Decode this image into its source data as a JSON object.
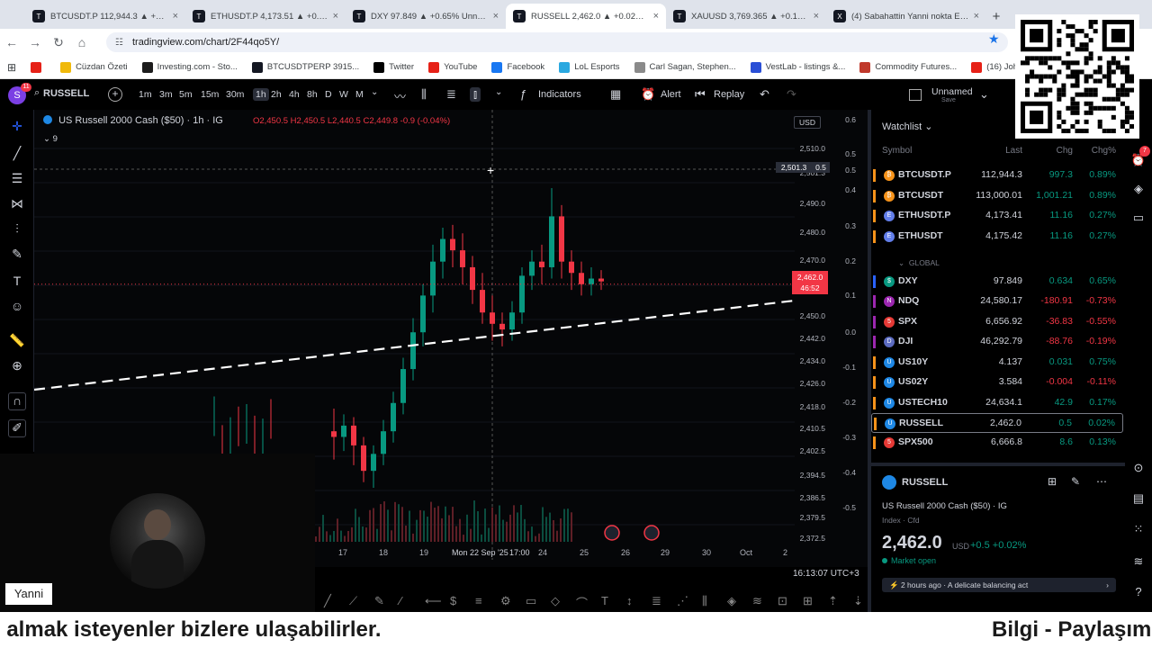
{
  "browser": {
    "tabs": [
      {
        "title": "BTCUSDT.P 112,944.3 ▲ +0.89%",
        "icon": "T"
      },
      {
        "title": "ETHUSDT.P 4,173.51 ▲ +0.27%",
        "icon": "T"
      },
      {
        "title": "DXY 97.849 ▲ +0.65% Unname",
        "icon": "T"
      },
      {
        "title": "RUSSELL 2,462.0 ▲ +0.02% Un",
        "icon": "T"
      },
      {
        "title": "XAUUSD 3,769.365 ▲ +0.14%",
        "icon": "T"
      },
      {
        "title": "(4) Sabahattin Yanni nokta Eteh",
        "icon": "X"
      }
    ],
    "url": "tradingview.com/chart/2F44qo5Y/",
    "bookmarks": [
      {
        "label": "",
        "color": "#e62117"
      },
      {
        "label": "Cüzdan Özeti",
        "color": "#f0b90b"
      },
      {
        "label": "Investing.com - Sto...",
        "color": "#1c1c1c"
      },
      {
        "label": "BTCUSDTPERP 3915...",
        "color": "#131722"
      },
      {
        "label": "Twitter",
        "color": "#000000"
      },
      {
        "label": "YouTube",
        "color": "#e62117"
      },
      {
        "label": "Facebook",
        "color": "#1877f2"
      },
      {
        "label": "LoL Esports",
        "color": "#2aa8e0"
      },
      {
        "label": "Carl Sagan, Stephen...",
        "color": "#8a8a8a"
      },
      {
        "label": "VestLab - listings &...",
        "color": "#2a4fd6"
      },
      {
        "label": "Commodity Futures...",
        "color": "#c0392b"
      },
      {
        "label": "(16) Johnny Cash -...",
        "color": "#e62117"
      }
    ]
  },
  "header": {
    "avatar_letter": "S",
    "avatar_badge": "11",
    "symbol": "RUSSELL",
    "timeframes": [
      "1m",
      "3m",
      "5m",
      "15m",
      "30m",
      "1h",
      "2h",
      "4h",
      "8h",
      "D",
      "W",
      "M"
    ],
    "active_timeframe": "1h",
    "indicators_label": "Indicators",
    "alert_label": "Alert",
    "replay_label": "Replay",
    "layout_name": "Unnamed",
    "layout_sub": "Save"
  },
  "chart": {
    "title": "US Russell 2000 Cash ($50) · 1h · IG",
    "ohlc": "O2,450.5 H2,450.5 L2,440.5 C2,449.8 -0.9 (-0.04%)",
    "indicator_count": "9",
    "currency": "USD",
    "price_ticks": [
      "2,510.0",
      "2,501.3",
      "2,490.0",
      "2,480.0",
      "2,470.0",
      "2,462.0",
      "2,450.0",
      "2,442.0",
      "2,434.0",
      "2,426.0",
      "2,418.0",
      "2,410.5",
      "2,402.5",
      "2,394.5",
      "2,386.5",
      "2,379.5",
      "2,372.5"
    ],
    "pct_ticks": [
      "0.6",
      "0.5",
      "0.5",
      "0.4",
      "0.3",
      "0.2",
      "0.1",
      "0.0",
      "-0.1",
      "-0.2",
      "-0.3",
      "-0.4",
      "-0.5"
    ],
    "last_price": "2,462.0",
    "countdown": "46:52",
    "crosshair_price": "2,501.3",
    "crosshair_pct": "0.5",
    "x_ticks": [
      "17",
      "18",
      "19",
      "Mon 22 Sep '25",
      "17:00",
      "24",
      "25",
      "26",
      "29",
      "30",
      "Oct",
      "2"
    ],
    "clock": "16:13:07 UTC+3",
    "candles": [
      [
        2410,
        2408,
        2400,
        2418
      ],
      [
        2408,
        2412,
        2403,
        2416
      ],
      [
        2412,
        2405,
        2398,
        2415
      ],
      [
        2405,
        2396,
        2392,
        2408
      ],
      [
        2396,
        2402,
        2390,
        2405
      ],
      [
        2402,
        2410,
        2398,
        2414
      ],
      [
        2410,
        2420,
        2406,
        2424
      ],
      [
        2420,
        2432,
        2416,
        2436
      ],
      [
        2432,
        2445,
        2428,
        2450
      ],
      [
        2445,
        2458,
        2440,
        2462
      ],
      [
        2458,
        2470,
        2452,
        2476
      ],
      [
        2470,
        2478,
        2464,
        2482
      ],
      [
        2478,
        2474,
        2468,
        2483
      ],
      [
        2474,
        2468,
        2462,
        2480
      ],
      [
        2468,
        2460,
        2455,
        2472
      ],
      [
        2460,
        2452,
        2448,
        2466
      ],
      [
        2452,
        2448,
        2442,
        2458
      ],
      [
        2448,
        2446,
        2440,
        2452
      ],
      [
        2446,
        2452,
        2442,
        2456
      ],
      [
        2452,
        2465,
        2448,
        2468
      ],
      [
        2465,
        2470,
        2460,
        2474
      ],
      [
        2470,
        2468,
        2462,
        2476
      ],
      [
        2468,
        2486,
        2464,
        2496
      ],
      [
        2486,
        2470,
        2464,
        2490
      ],
      [
        2470,
        2466,
        2460,
        2474
      ],
      [
        2466,
        2462,
        2458,
        2470
      ],
      [
        2462,
        2464,
        2458,
        2468
      ],
      [
        2464,
        2463,
        2460,
        2467
      ]
    ]
  },
  "watchlist": {
    "title": "Watchlist",
    "columns": [
      "Symbol",
      "Last",
      "Chg",
      "Chg%"
    ],
    "section": "GLOBAL",
    "rows": [
      {
        "sym": "BTCUSDT.P",
        "last": "112,944.3",
        "chg": "997.3",
        "chgp": "0.89%",
        "dir": "pos",
        "dot": "#f7931a",
        "flag": "#f7931a",
        "icon": "₿"
      },
      {
        "sym": "BTCUSDT",
        "last": "113,000.01",
        "chg": "1,001.21",
        "chgp": "0.89%",
        "dir": "pos",
        "dot": "#f7931a",
        "flag": "#f7931a",
        "icon": "₿"
      },
      {
        "sym": "ETHUSDT.P",
        "last": "4,173.41",
        "chg": "11.16",
        "chgp": "0.27%",
        "dir": "pos",
        "dot": "#627eea",
        "flag": "#f7931a",
        "icon": "E"
      },
      {
        "sym": "ETHUSDT",
        "last": "4,175.42",
        "chg": "11.16",
        "chgp": "0.27%",
        "dir": "pos",
        "dot": "#627eea",
        "flag": "#f7931a",
        "icon": "E"
      },
      {
        "sym": "DXY",
        "last": "97.849",
        "chg": "0.634",
        "chgp": "0.65%",
        "dir": "pos",
        "dot": "#089981",
        "flag": "#2962ff",
        "icon": "$"
      },
      {
        "sym": "NDQ",
        "last": "24,580.17",
        "chg": "-180.91",
        "chgp": "-0.73%",
        "dir": "neg",
        "dot": "#9c27b0",
        "flag": "#9c27b0",
        "icon": "N"
      },
      {
        "sym": "SPX",
        "last": "6,656.92",
        "chg": "-36.83",
        "chgp": "-0.55%",
        "dir": "neg",
        "dot": "#e53935",
        "flag": "#9c27b0",
        "icon": "5"
      },
      {
        "sym": "DJI",
        "last": "46,292.79",
        "chg": "-88.76",
        "chgp": "-0.19%",
        "dir": "neg",
        "dot": "#5c6bc0",
        "flag": "#9c27b0",
        "icon": "D"
      },
      {
        "sym": "US10Y",
        "last": "4.137",
        "chg": "0.031",
        "chgp": "0.75%",
        "dir": "pos",
        "dot": "#1e88e5",
        "flag": "#f7931a",
        "icon": "U"
      },
      {
        "sym": "US02Y",
        "last": "3.584",
        "chg": "-0.004",
        "chgp": "-0.11%",
        "dir": "neg",
        "dot": "#1e88e5",
        "flag": "#f7931a",
        "icon": "U"
      },
      {
        "sym": "USTECH10",
        "last": "24,634.1",
        "chg": "42.9",
        "chgp": "0.17%",
        "dir": "pos",
        "dot": "#1e88e5",
        "flag": "#f7931a",
        "icon": "U"
      },
      {
        "sym": "RUSSELL",
        "last": "2,462.0",
        "chg": "0.5",
        "chgp": "0.02%",
        "dir": "pos",
        "dot": "#1e88e5",
        "flag": "#f7931a",
        "icon": "U"
      },
      {
        "sym": "SPX500",
        "last": "6,666.8",
        "chg": "8.6",
        "chgp": "0.13%",
        "dir": "pos",
        "dot": "#e53935",
        "flag": "#f7931a",
        "icon": "5"
      }
    ]
  },
  "details": {
    "symbol": "RUSSELL",
    "name": "US Russell 2000 Cash ($50) · IG",
    "type": "Index · Cfd",
    "price": "2,462.0",
    "currency": "USD",
    "change": "+0.5  +0.02%",
    "market_status": "Market open",
    "news": "2 hours ago · A delicate balancing act"
  },
  "stream": {
    "presenter_name": "Yanni",
    "ticker_left": "i almak isteyenler bizlere ulaşabilirler.",
    "ticker_right": "Bilgi - Paylaşım"
  }
}
